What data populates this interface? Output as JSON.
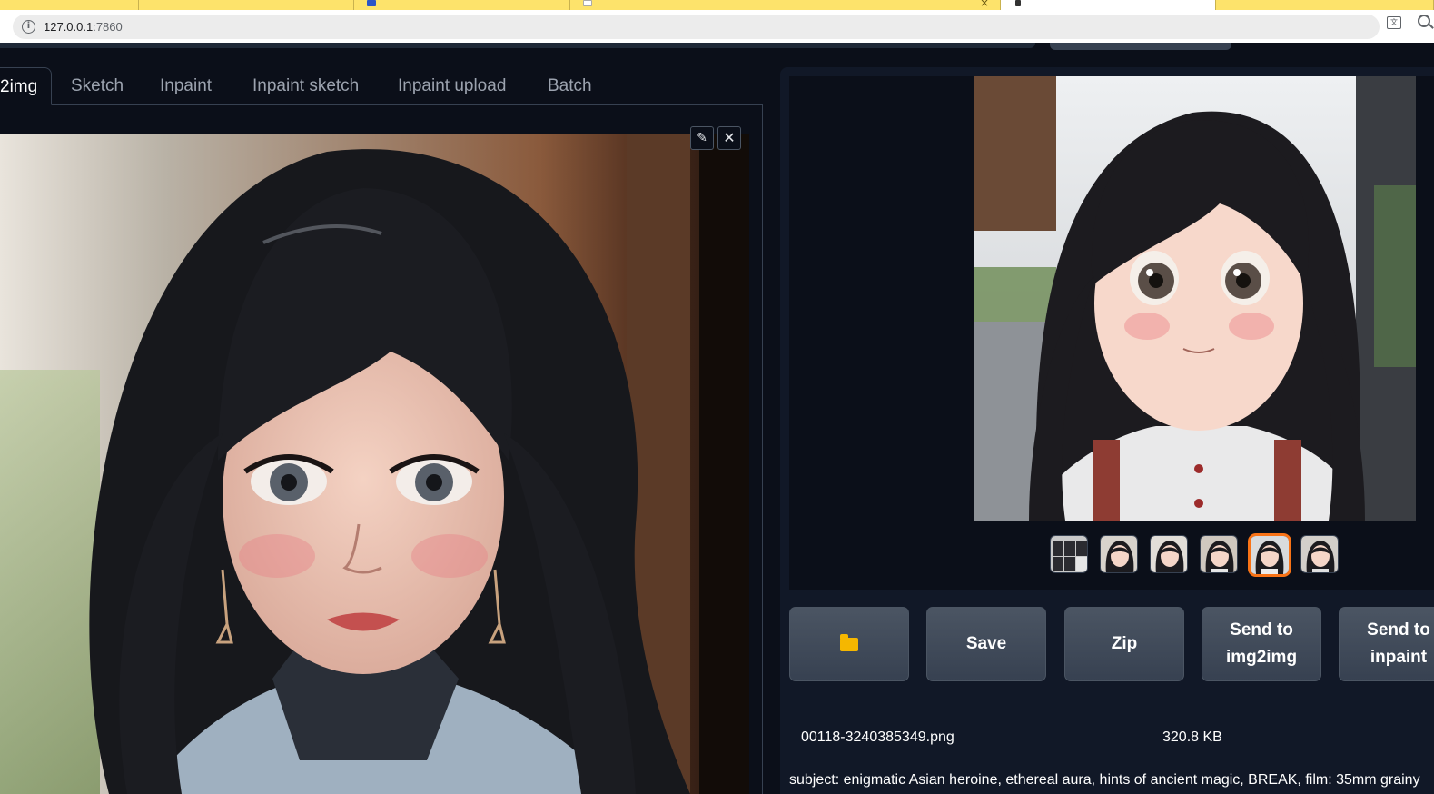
{
  "browser": {
    "url_host": "127.0.0.1",
    "url_port": ":7860"
  },
  "tabs": [
    {
      "label": "2img",
      "active": true
    },
    {
      "label": "Sketch"
    },
    {
      "label": "Inpaint"
    },
    {
      "label": "Inpaint sketch"
    },
    {
      "label": "Inpaint upload"
    },
    {
      "label": "Batch"
    }
  ],
  "input_image": {
    "edit_icon": "pencil-icon",
    "clear_icon": "close-icon"
  },
  "gallery": {
    "thumbnail_count": 6,
    "selected_index": 4
  },
  "actions": {
    "folder_icon": "folder-icon",
    "save_label": "Save",
    "zip_label": "Zip",
    "send_img2img_line1": "Send to",
    "send_img2img_line2": "img2img",
    "send_inpaint_line1": "Send to",
    "send_inpaint_line2": "inpaint"
  },
  "file": {
    "name": "00118-3240385349.png",
    "size": "320.8 KB"
  },
  "prompt": "subject: enigmatic Asian heroine, ethereal aura, hints of ancient magic, BREAK, film: 35mm grainy",
  "colors": {
    "background": "#0b0f19",
    "panel": "#111827",
    "button": "#4b5563",
    "selected_thumb": "#f97316",
    "browser_tab": "#fde36b"
  }
}
